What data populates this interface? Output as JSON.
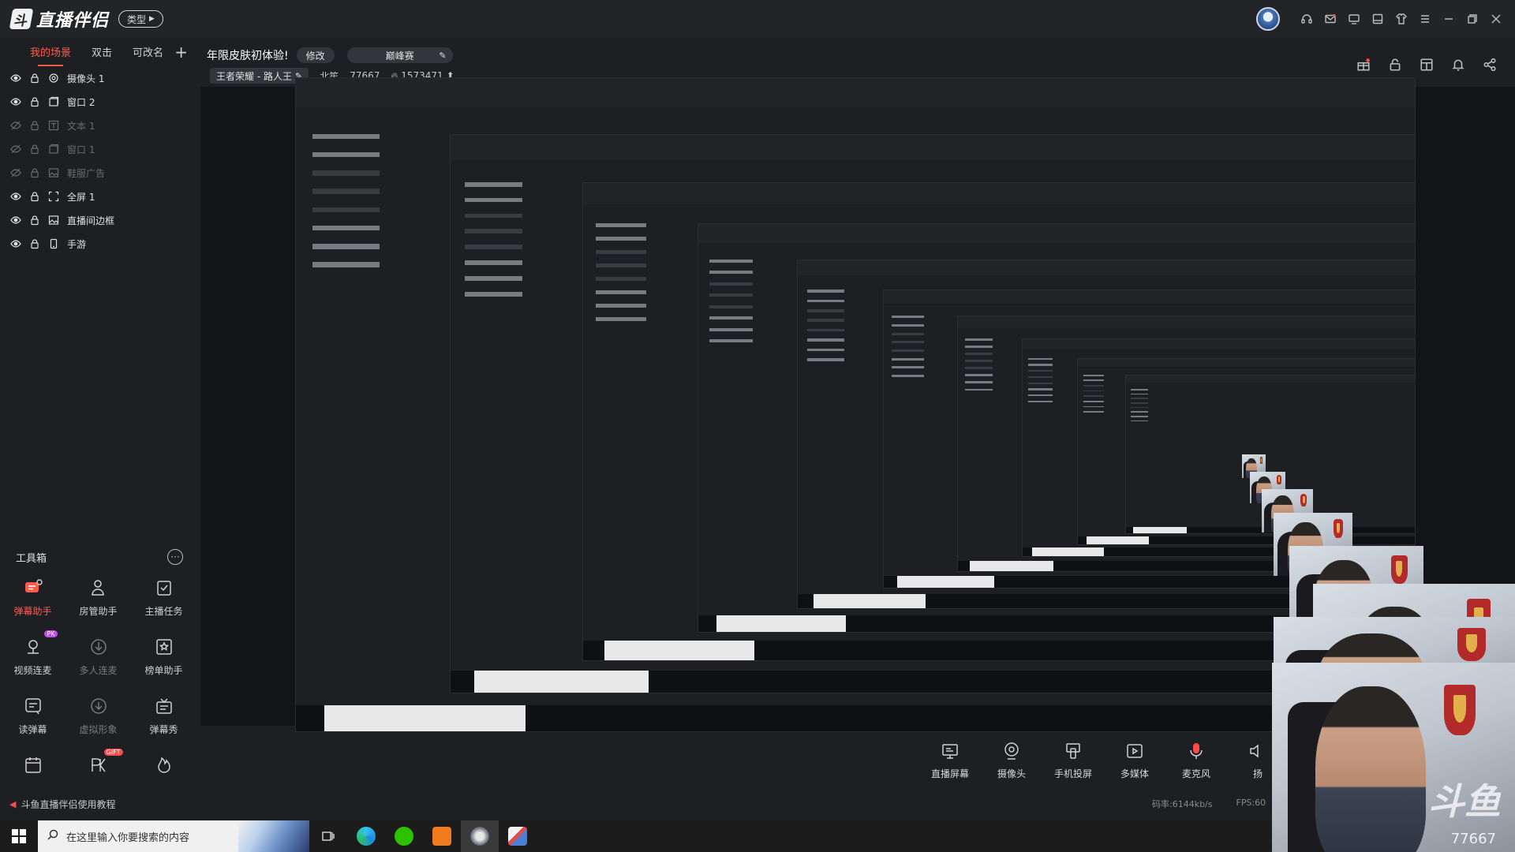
{
  "app": {
    "logo_mark": "斗",
    "logo_text": "直播伴侣",
    "type_pill": "类型"
  },
  "scene_tabs": [
    "我的场景",
    "双击",
    "可改名"
  ],
  "add_scene": "+",
  "sources": [
    {
      "label": "摄像头 1",
      "icon": "camera-icon",
      "visible": true
    },
    {
      "label": "窗口 2",
      "icon": "window-icon",
      "visible": true
    },
    {
      "label": "文本 1",
      "icon": "text-icon",
      "visible": false
    },
    {
      "label": "窗口 1",
      "icon": "window-icon",
      "visible": false
    },
    {
      "label": "鞋服广告",
      "icon": "image-icon",
      "visible": false
    },
    {
      "label": "全屏 1",
      "icon": "fullscreen-icon",
      "visible": true
    },
    {
      "label": "直播间边框",
      "icon": "image-icon",
      "visible": true
    },
    {
      "label": "手游",
      "icon": "phone-icon",
      "visible": true
    }
  ],
  "room": {
    "title": "年限皮肤初体验!",
    "edit_label": "修改",
    "category": "巅峰赛",
    "game": "王者荣耀 - 路人王",
    "region": "北笙",
    "room_id": "77667",
    "hot": "1573471"
  },
  "toolbox": {
    "title": "工具箱",
    "more": "···",
    "tools": [
      {
        "label": "弹幕助手",
        "icon": "danmaku-icon",
        "state": "active"
      },
      {
        "label": "房管助手",
        "icon": "admin-icon",
        "state": "normal"
      },
      {
        "label": "主播任务",
        "icon": "task-icon",
        "state": "normal"
      },
      {
        "label": "视频连麦",
        "icon": "video-link-icon",
        "state": "normal",
        "badge": "PK"
      },
      {
        "label": "多人连麦",
        "icon": "multi-link-icon",
        "state": "dim"
      },
      {
        "label": "榜单助手",
        "icon": "rank-icon",
        "state": "normal"
      },
      {
        "label": "读弹幕",
        "icon": "read-danmaku-icon",
        "state": "normal"
      },
      {
        "label": "虚拟形象",
        "icon": "avatar-figure-icon",
        "state": "dim"
      },
      {
        "label": "弹幕秀",
        "icon": "danmaku-show-icon",
        "state": "normal"
      },
      {
        "label": "",
        "icon": "calendar-icon",
        "state": "normal"
      },
      {
        "label": "",
        "icon": "pk-icon",
        "state": "normal",
        "badge": "GIFT"
      },
      {
        "label": "",
        "icon": "fire-icon",
        "state": "normal"
      }
    ]
  },
  "controls": [
    {
      "label": "直播屏幕",
      "icon": "screen-icon"
    },
    {
      "label": "摄像头",
      "icon": "webcam-icon"
    },
    {
      "label": "手机投屏",
      "icon": "phone-cast-icon"
    },
    {
      "label": "多媒体",
      "icon": "media-icon"
    },
    {
      "label": "麦克风",
      "icon": "mic-icon"
    },
    {
      "label": "扬",
      "icon": "speaker-icon"
    }
  ],
  "status": {
    "tutorial": "斗鱼直播伴侣使用教程",
    "bitrate": "码率:6144kb/s",
    "fps": "FPS:60"
  },
  "taskbar": {
    "search_placeholder": "在这里输入你要搜索的内容"
  },
  "camera": {
    "watermark": "斗鱼",
    "room_number": "77667"
  },
  "colors": {
    "accent": "#ff5a4a",
    "background": "#1e1f23",
    "topbar": "#232428"
  }
}
